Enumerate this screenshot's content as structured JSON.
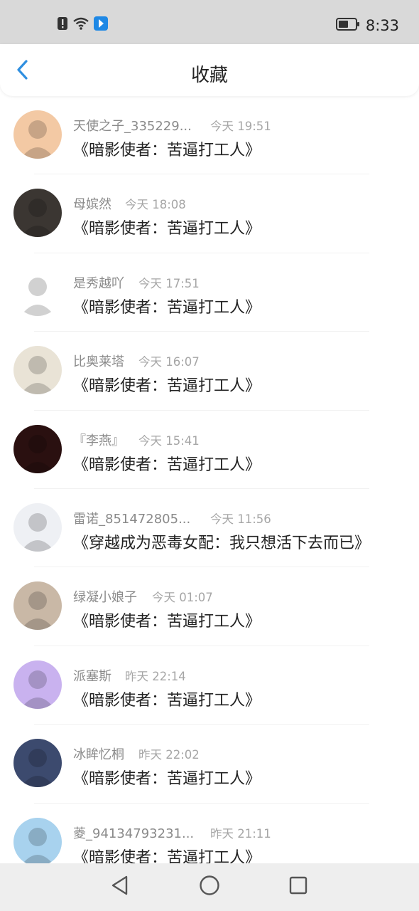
{
  "status_bar": {
    "time": "8:33",
    "icons": [
      "alert-icon",
      "wifi-icon",
      "app-notification-icon",
      "battery-icon"
    ]
  },
  "header": {
    "title": "收藏",
    "back_icon": "chevron-left-icon"
  },
  "favorites": [
    {
      "name": "天使之子_335229...",
      "time": "今天 19:51",
      "work": "《暗影使者：苦逼打工人》",
      "avatar_color": "#f3c9a4"
    },
    {
      "name": "母嫔然",
      "time": "今天 18:08",
      "work": "《暗影使者：苦逼打工人》",
      "avatar_color": "#3b3632"
    },
    {
      "name": "是秀越吖",
      "time": "今天 17:51",
      "work": "《暗影使者：苦逼打工人》",
      "avatar_color": "#ffffff"
    },
    {
      "name": "比奥莱塔",
      "time": "今天 16:07",
      "work": "《暗影使者：苦逼打工人》",
      "avatar_color": "#e9e3d6"
    },
    {
      "name": "『李燕』",
      "time": "今天 15:41",
      "work": "《暗影使者：苦逼打工人》",
      "avatar_color": "#2a1010"
    },
    {
      "name": "雷诺_851472805...",
      "time": "今天 11:56",
      "work": "《穿越成为恶毒女配：我只想活下去而已》",
      "avatar_color": "#eef0f4"
    },
    {
      "name": "绿凝小娘子",
      "time": "今天 01:07",
      "work": "《暗影使者：苦逼打工人》",
      "avatar_color": "#c9b8a6"
    },
    {
      "name": "派塞斯",
      "time": "昨天 22:14",
      "work": "《暗影使者：苦逼打工人》",
      "avatar_color": "#c9b2ef"
    },
    {
      "name": "冰眸忆桐",
      "time": "昨天 22:02",
      "work": "《暗影使者：苦逼打工人》",
      "avatar_color": "#3c4a6e"
    },
    {
      "name": "菱_94134793231...",
      "time": "昨天 21:11",
      "work": "《暗影使者：苦逼打工人》",
      "avatar_color": "#a8d2ee"
    }
  ],
  "nav_bar": {
    "icons": [
      "back-triangle-icon",
      "home-circle-icon",
      "recents-square-icon"
    ]
  },
  "colors": {
    "accent": "#2f8fe0",
    "name_text": "#8a8a8a",
    "time_text": "#a6a6a6",
    "work_text": "#222222"
  }
}
